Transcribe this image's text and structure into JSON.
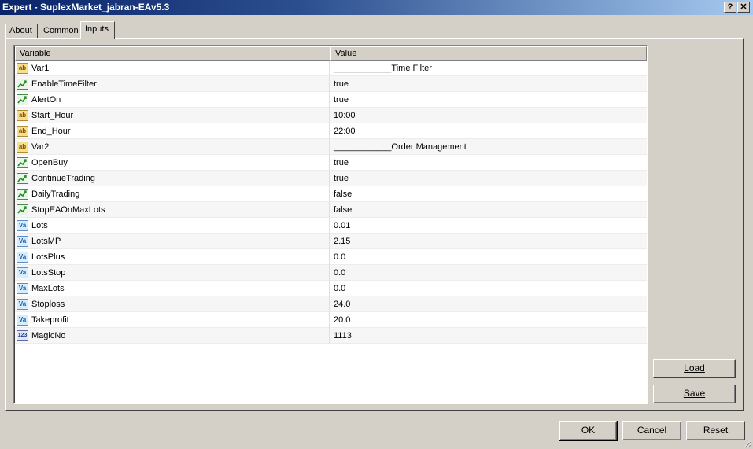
{
  "window": {
    "title": "Expert - SuplexMarket_jabran-EAv5.3",
    "help_glyph": "?",
    "close_glyph": "✕"
  },
  "tabs": [
    {
      "label": "About"
    },
    {
      "label": "Common"
    },
    {
      "label": "Inputs"
    }
  ],
  "grid": {
    "col_variable": "Variable",
    "col_value": "Value",
    "rows": [
      {
        "icon": "ab",
        "type": "string",
        "name": "Var1",
        "value": "____________Time Filter"
      },
      {
        "icon": "bool",
        "type": "bool",
        "name": "EnableTimeFilter",
        "value": "true"
      },
      {
        "icon": "bool",
        "type": "bool",
        "name": "AlertOn",
        "value": "true"
      },
      {
        "icon": "ab",
        "type": "string",
        "name": "Start_Hour",
        "value": "10:00"
      },
      {
        "icon": "ab",
        "type": "string",
        "name": "End_Hour",
        "value": "22:00"
      },
      {
        "icon": "ab",
        "type": "string",
        "name": "Var2",
        "value": "____________Order Management"
      },
      {
        "icon": "bool",
        "type": "bool",
        "name": "OpenBuy",
        "value": "true"
      },
      {
        "icon": "bool",
        "type": "bool",
        "name": "ContinueTrading",
        "value": "true"
      },
      {
        "icon": "bool",
        "type": "bool",
        "name": "DailyTrading",
        "value": "false"
      },
      {
        "icon": "bool",
        "type": "bool",
        "name": "StopEAOnMaxLots",
        "value": "false"
      },
      {
        "icon": "Va",
        "type": "double",
        "name": "Lots",
        "value": "0.01"
      },
      {
        "icon": "Va",
        "type": "double",
        "name": "LotsMP",
        "value": "2.15"
      },
      {
        "icon": "Va",
        "type": "double",
        "name": "LotsPlus",
        "value": "0.0"
      },
      {
        "icon": "Va",
        "type": "double",
        "name": "LotsStop",
        "value": "0.0"
      },
      {
        "icon": "Va",
        "type": "double",
        "name": "MaxLots",
        "value": "0.0"
      },
      {
        "icon": "Va",
        "type": "double",
        "name": "Stoploss",
        "value": "24.0"
      },
      {
        "icon": "Va",
        "type": "double",
        "name": "Takeprofit",
        "value": "20.0"
      },
      {
        "icon": "123",
        "type": "int",
        "name": "MagicNo",
        "value": "1113"
      }
    ]
  },
  "buttons": {
    "load": "Load",
    "save": "Save",
    "ok": "OK",
    "cancel": "Cancel",
    "reset": "Reset"
  }
}
